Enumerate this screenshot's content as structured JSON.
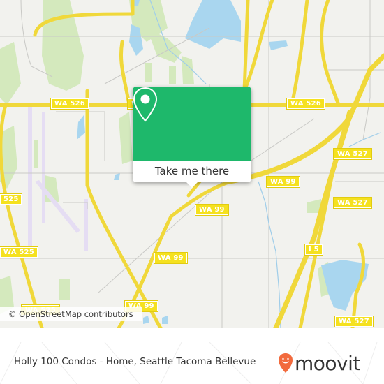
{
  "map": {
    "attribution": "© OpenStreetMap contributors",
    "route_shields": [
      {
        "id": "wa526-left",
        "label": "WA 526"
      },
      {
        "id": "wa526-mid",
        "label": "WA 526"
      },
      {
        "id": "wa526-right",
        "label": "WA 526"
      },
      {
        "id": "wa527-top",
        "label": "WA 527"
      },
      {
        "id": "wa527-mid",
        "label": "WA 527"
      },
      {
        "id": "wa527-bottom",
        "label": "WA 527"
      },
      {
        "id": "wa99-a",
        "label": "WA 99"
      },
      {
        "id": "wa99-b",
        "label": "WA 99"
      },
      {
        "id": "wa99-c",
        "label": "WA 99"
      },
      {
        "id": "wa99-d",
        "label": "WA 99"
      },
      {
        "id": "i5",
        "label": "I 5"
      },
      {
        "id": "wa525-top",
        "label": "525"
      },
      {
        "id": "wa525-mid",
        "label": "WA 525"
      },
      {
        "id": "wa525-bottom",
        "label": "WA 525"
      }
    ],
    "colors": {
      "land": "#f2f2ee",
      "road": "#f6e35c",
      "water": "#a9d6ef",
      "park": "#cfe8b2",
      "runway": "#e3dcf2",
      "accent": "#1eb86b"
    }
  },
  "popup": {
    "icon": "location-pin-icon",
    "button_label": "Take me there"
  },
  "footer": {
    "title": "Holly 100 Condos - Home, Seattle Tacoma Bellevue",
    "brand": "moovit",
    "brand_color": "#f26a3d"
  }
}
